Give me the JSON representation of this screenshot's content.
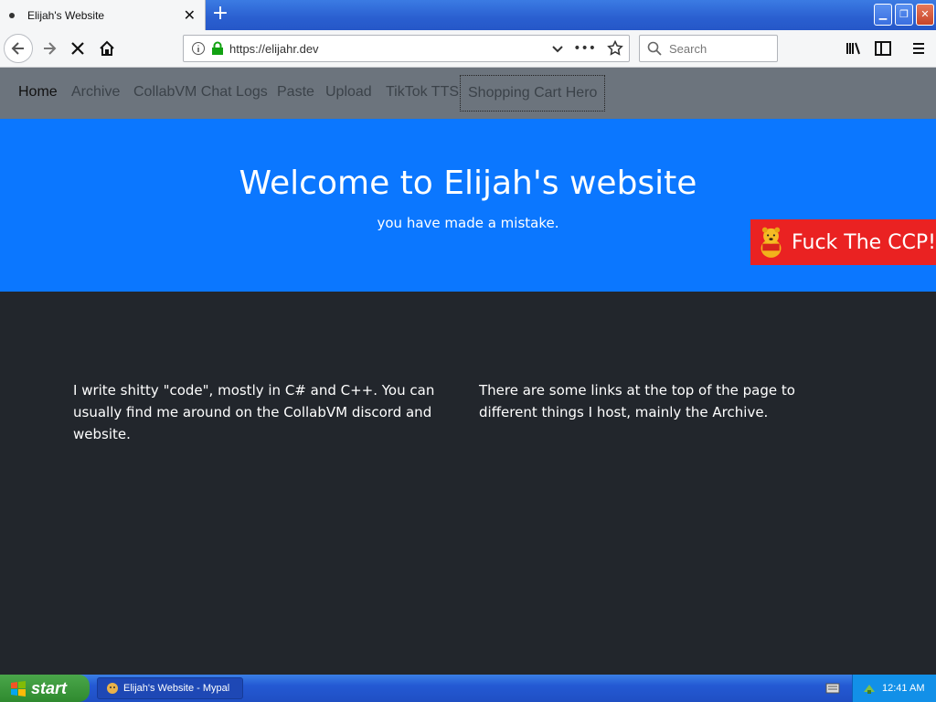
{
  "browser": {
    "tab_title": "Elijah's Website",
    "new_tab": "+",
    "url": "https://elijahr.dev",
    "search_placeholder": "Search"
  },
  "site": {
    "nav": [
      "Home",
      "Archive",
      "CollabVM Chat Logs",
      "Paste",
      "Upload",
      "TikTok TTS",
      "Shopping Cart Hero"
    ],
    "hero_title": "Welcome to Elijah's website",
    "hero_subtitle": "you have made a mistake.",
    "banner_text": "Fuck The CCP!",
    "col1": "I write shitty \"code\", mostly in C# and C++. You can usually find me around on the CollabVM discord and website.",
    "col2": "There are some links at the top of the page to different things I host, mainly the Archive."
  },
  "taskbar": {
    "start_label": "start",
    "task_label": "Elijah's Website - Mypal",
    "clock": "12:41 AM"
  },
  "colors": {
    "hero_bg": "#0b77ff",
    "content_bg": "#22262c",
    "nav_bg": "#6c747d",
    "banner_bg": "#ea2222"
  }
}
